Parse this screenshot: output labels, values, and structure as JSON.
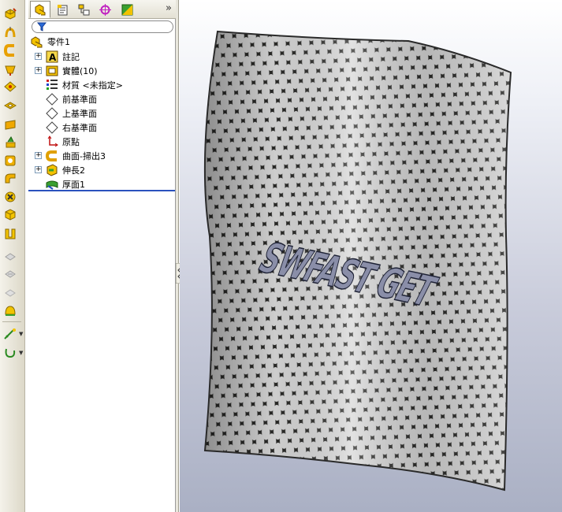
{
  "feature_manager": {
    "tabs": [
      {
        "icon": "feature-tree-icon",
        "active": true
      },
      {
        "icon": "property-manager-icon",
        "active": false
      },
      {
        "icon": "configuration-manager-icon",
        "active": false
      },
      {
        "icon": "dimxpert-icon",
        "active": false
      },
      {
        "icon": "display-manager-icon",
        "active": false
      }
    ],
    "more": "»",
    "filter_icon": "filter-icon",
    "tree": [
      {
        "label": "零件1",
        "icon": "part-icon",
        "expander": ""
      },
      {
        "label": "註記",
        "icon": "annotations-icon",
        "expander": "+"
      },
      {
        "label": "實體(10)",
        "icon": "solid-bodies-icon",
        "expander": "+"
      },
      {
        "label": "材質 <未指定>",
        "icon": "material-icon",
        "expander": ""
      },
      {
        "label": "前基準面",
        "icon": "plane-icon",
        "expander": ""
      },
      {
        "label": "上基準面",
        "icon": "plane-icon",
        "expander": ""
      },
      {
        "label": "右基準面",
        "icon": "plane-icon",
        "expander": ""
      },
      {
        "label": "原點",
        "icon": "origin-icon",
        "expander": ""
      },
      {
        "label": "曲面-掃出3",
        "icon": "surface-sweep-icon",
        "expander": "+"
      },
      {
        "label": "伸長2",
        "icon": "extrude-icon",
        "expander": "+"
      },
      {
        "label": "厚面1",
        "icon": "thicken-icon",
        "expander": ""
      }
    ]
  },
  "toolbar": {
    "buttons": [
      "extruded-boss-icon",
      "revolved-boss-icon",
      "swept-boss-icon",
      "lofted-boss-icon",
      "boundary-boss-icon",
      "extruded-cut-icon",
      "hole-wizard-icon",
      "revolved-cut-icon",
      "swept-cut-icon",
      "lofted-cut-icon",
      "fillet-icon",
      "linear-pattern-icon",
      "rib-icon",
      "draft-icon",
      "shell-icon",
      "wrap-icon",
      "dome-icon",
      "reference-geometry-icon",
      "curves-icon"
    ]
  },
  "viewport": {
    "model_text": "SWFAST GET",
    "colors": {
      "background_top": "#ffffff",
      "background_bottom": "#aab0c4",
      "mesh_light": "#e2e2e2",
      "mesh_dark": "#2a2a28"
    }
  }
}
